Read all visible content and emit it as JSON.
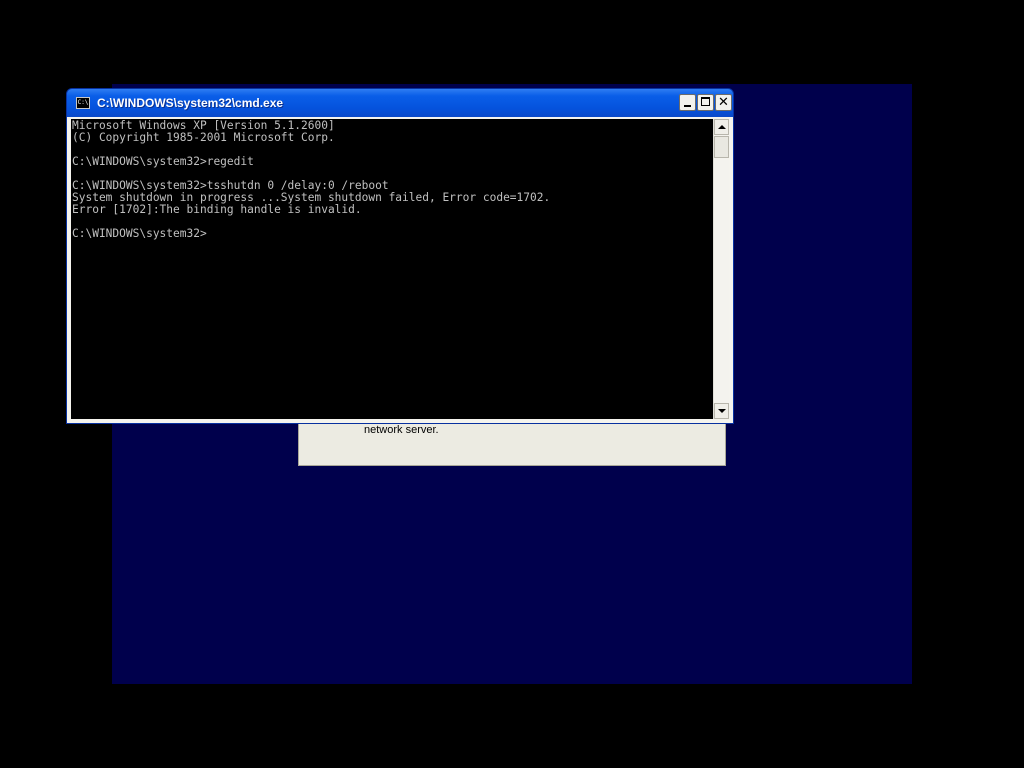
{
  "window": {
    "title": "C:\\WINDOWS\\system32\\cmd.exe",
    "icon_label": "C:\\",
    "controls": {
      "minimize": "minimize-icon",
      "maximize": "maximize-icon",
      "close": "close-icon",
      "close_glyph": "✕"
    }
  },
  "console": {
    "lines": [
      "Microsoft Windows XP [Version 5.1.2600]",
      "(C) Copyright 1985-2001 Microsoft Corp.",
      "",
      "C:\\WINDOWS\\system32>regedit",
      "",
      "C:\\WINDOWS\\system32>tsshutdn 0 /delay:0 /reboot",
      "System shutdown in progress ...System shutdown failed, Error code=1702.",
      "Error [1702]:The binding handle is invalid.",
      "",
      "C:\\WINDOWS\\system32>"
    ]
  },
  "background_dialog": {
    "text": "network server."
  },
  "colors": {
    "desktop": "#00004c",
    "titlebar": "#0552dc",
    "console_bg": "#000000",
    "console_fg": "#c0c0c0"
  }
}
